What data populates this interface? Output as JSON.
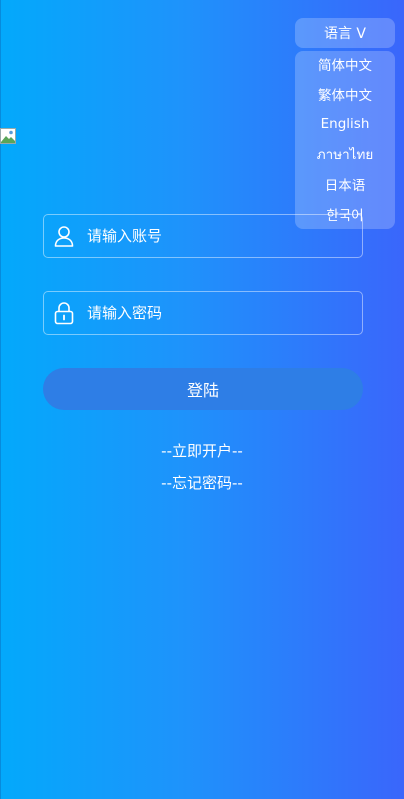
{
  "language": {
    "toggle_label": "语言 V",
    "options": [
      "简体中文",
      "繁体中文",
      "English",
      "ภาษาไทย",
      "日本语",
      "한국어"
    ]
  },
  "form": {
    "account_placeholder": "请输入账号",
    "password_placeholder": "请输入密码",
    "login_label": "登陆"
  },
  "links": {
    "register": "--立即开户--",
    "forgot_password": "--忘记密码--"
  },
  "colors": {
    "gradient_start": "#03a9fb",
    "gradient_end": "#3a66fb",
    "button": "#2e7ee6"
  },
  "icons": [
    "broken-image-icon",
    "user-icon",
    "lock-icon"
  ]
}
